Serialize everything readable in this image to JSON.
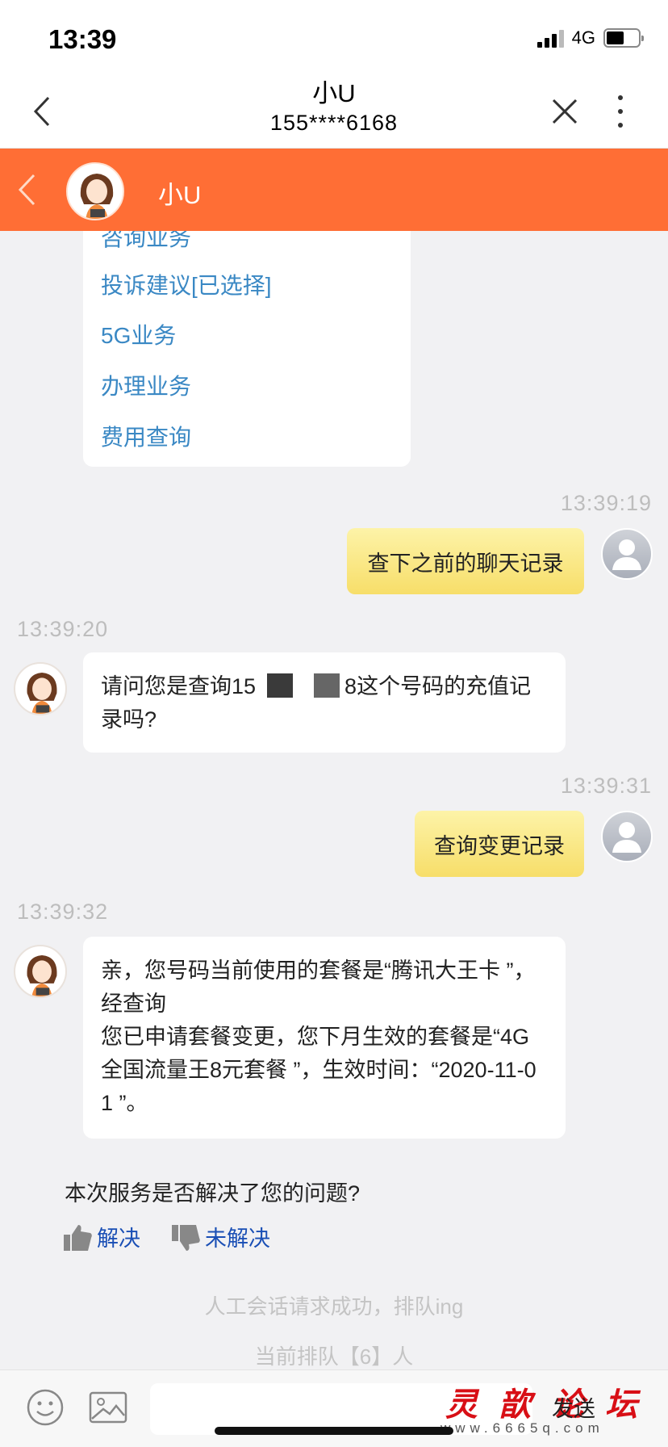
{
  "status": {
    "time": "13:39",
    "network": "4G"
  },
  "nav": {
    "title": "小U",
    "phone": "155****6168"
  },
  "header": {
    "agent_name": "小U"
  },
  "menu": {
    "items": [
      "咨询业务",
      "投诉建议[已选择]",
      "5G业务",
      "办理业务",
      "费用查询"
    ]
  },
  "messages": [
    {
      "from": "user",
      "time": "13:39:19",
      "text": "查下之前的聊天记录"
    },
    {
      "from": "bot",
      "time": "13:39:20",
      "text_a": "请问您是查询15",
      "text_b": "8这个号码的充值记录吗?"
    },
    {
      "from": "user",
      "time": "13:39:31",
      "text": "查询变更记录"
    },
    {
      "from": "bot",
      "time": "13:39:32",
      "text": "亲，您号码当前使用的套餐是“腾讯大王卡 ”，经查询\n您已申请套餐变更，您下月生效的套餐是“4G全国流量王8元套餐 ”，生效时间：“2020-11-01 ”。"
    }
  ],
  "survey": {
    "question": "本次服务是否解决了您的问题?",
    "resolved": "解决",
    "unresolved": "未解决"
  },
  "system": {
    "queue_success": "人工会话请求成功，排队ing",
    "queue_position": "当前排队【6】人"
  },
  "input": {
    "placeholder": "",
    "send_label": "发送"
  },
  "watermark": {
    "text": "灵歆论坛",
    "url": "www.6665q.com"
  },
  "colors": {
    "header_orange": "#ff6e35",
    "link_blue": "#3a88c4",
    "bubble_yellow": "#f7de69"
  }
}
